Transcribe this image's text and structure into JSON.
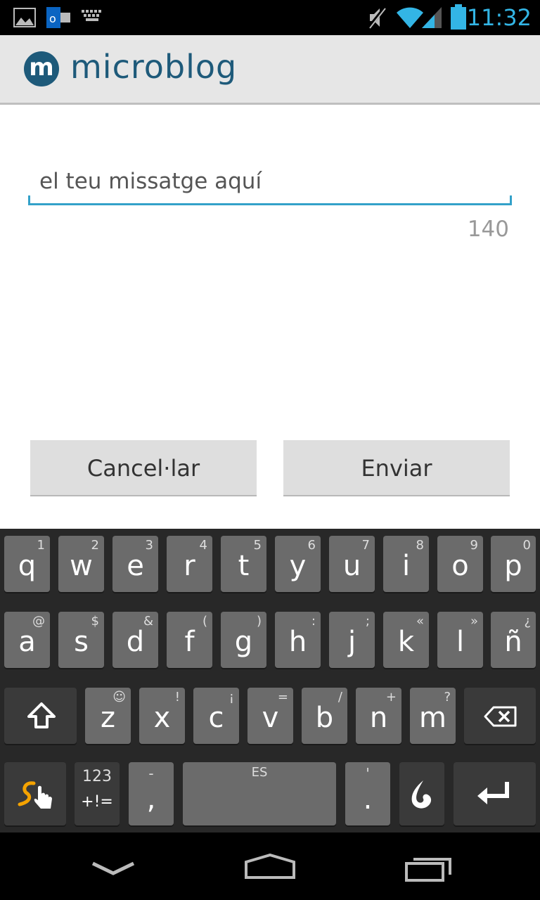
{
  "status_bar": {
    "time": "11:32",
    "icons": [
      "image-icon",
      "outlook-icon",
      "keyboard-icon",
      "mute-icon",
      "wifi-icon",
      "signal-icon",
      "battery-icon"
    ],
    "accent_color": "#33b5e5"
  },
  "app_bar": {
    "logo_letter": "m",
    "title": "microblog",
    "brand_color": "#1e5a7a"
  },
  "compose": {
    "placeholder": "el teu missatge aquí",
    "char_counter": "140",
    "underline_color": "#33a1c9"
  },
  "buttons": {
    "cancel_label": "Cancel·lar",
    "send_label": "Enviar"
  },
  "keyboard": {
    "row1": [
      {
        "main": "q",
        "sub": "1"
      },
      {
        "main": "w",
        "sub": "2"
      },
      {
        "main": "e",
        "sub": "3"
      },
      {
        "main": "r",
        "sub": "4"
      },
      {
        "main": "t",
        "sub": "5"
      },
      {
        "main": "y",
        "sub": "6"
      },
      {
        "main": "u",
        "sub": "7"
      },
      {
        "main": "i",
        "sub": "8"
      },
      {
        "main": "o",
        "sub": "9"
      },
      {
        "main": "p",
        "sub": "0"
      }
    ],
    "row2": [
      {
        "main": "a",
        "sub": "@"
      },
      {
        "main": "s",
        "sub": "$"
      },
      {
        "main": "d",
        "sub": "&"
      },
      {
        "main": "f",
        "sub": "("
      },
      {
        "main": "g",
        "sub": ")"
      },
      {
        "main": "h",
        "sub": ":"
      },
      {
        "main": "j",
        "sub": ";"
      },
      {
        "main": "k",
        "sub": "«"
      },
      {
        "main": "l",
        "sub": "»"
      },
      {
        "main": "ñ",
        "sub": "¿"
      }
    ],
    "row3": [
      {
        "main": "z",
        "sub": "☺"
      },
      {
        "main": "x",
        "sub": "!"
      },
      {
        "main": "c",
        "sub": "¡"
      },
      {
        "main": "v",
        "sub": "="
      },
      {
        "main": "b",
        "sub": "/"
      },
      {
        "main": "n",
        "sub": "+"
      },
      {
        "main": "m",
        "sub": "?"
      }
    ],
    "symbols_key_top": "123",
    "symbols_key_bottom": "+!=",
    "comma_key": ",",
    "comma_sub": "-",
    "space_label": "ES",
    "period_key": ".",
    "period_sub": "'"
  },
  "nav_bar": {
    "icons": [
      "back-chevron-icon",
      "home-icon",
      "recents-icon"
    ]
  }
}
